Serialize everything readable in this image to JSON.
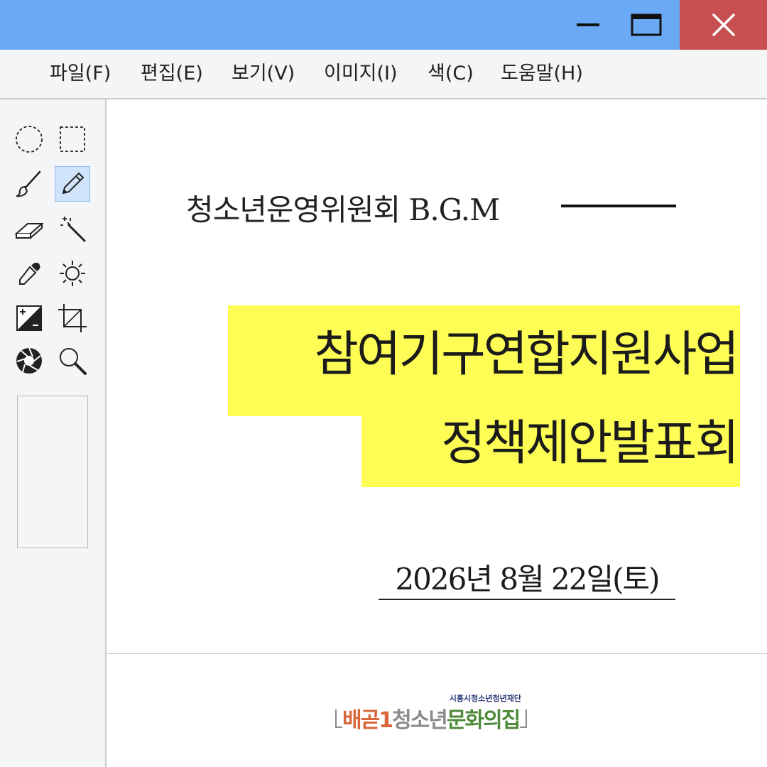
{
  "window": {
    "controls": {
      "minimize_icon": "minimize-icon",
      "maximize_icon": "maximize-icon",
      "close_icon": "close-icon"
    },
    "titlebar_color": "#6aaaf5",
    "close_color": "#c84f4f"
  },
  "menu": [
    {
      "label": "파일(F)"
    },
    {
      "label": "편집(E)"
    },
    {
      "label": "보기(V)"
    },
    {
      "label": "이미지(I)"
    },
    {
      "label": "색(C)"
    },
    {
      "label": "도움말(H)"
    }
  ],
  "tools": [
    {
      "icon": "ellipse-select-icon"
    },
    {
      "icon": "rect-select-icon"
    },
    {
      "icon": "brush-icon"
    },
    {
      "icon": "pencil-icon",
      "selected": true
    },
    {
      "icon": "eraser-icon"
    },
    {
      "icon": "magic-wand-icon"
    },
    {
      "icon": "eyedropper-icon"
    },
    {
      "icon": "brightness-icon"
    },
    {
      "icon": "contrast-icon"
    },
    {
      "icon": "crop-icon"
    },
    {
      "icon": "aperture-icon"
    },
    {
      "icon": "zoom-icon"
    }
  ],
  "poster": {
    "subtitle": "청소년운영위원회 B.G.M",
    "title_line1": "참여기구연합지원사업",
    "title_line2": "정책제안발표회",
    "date": "2026년 8월 22일(토)",
    "highlight_color": "#fdfd55"
  },
  "logo": {
    "org": "시흥시청소년청년재단",
    "name_part1": "배곧1",
    "name_part2": "청소년",
    "name_part3": "문화의집",
    "colors": {
      "part1": "#d8663a",
      "part2": "#8a8a8a",
      "part3": "#4f8a3a"
    }
  }
}
